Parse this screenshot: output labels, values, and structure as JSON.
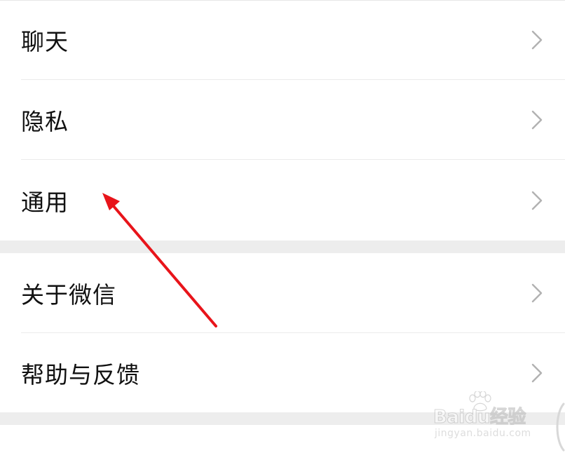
{
  "settings": {
    "group1": [
      {
        "label": "聊天"
      },
      {
        "label": "隐私"
      },
      {
        "label": "通用"
      }
    ],
    "group2": [
      {
        "label": "关于微信"
      },
      {
        "label": "帮助与反馈"
      }
    ]
  },
  "annotation": {
    "arrow_color": "#e8141a",
    "arrow_points_to": "通用"
  },
  "watermark": {
    "logo_text": "Baidu经验",
    "site_text": "jingyan.baidu.com"
  },
  "icons": {
    "chevron": "chevron-right-icon"
  },
  "colors": {
    "background": "#ededed",
    "cell": "#ffffff",
    "text": "#111111",
    "chevron": "#b2b2b2"
  }
}
